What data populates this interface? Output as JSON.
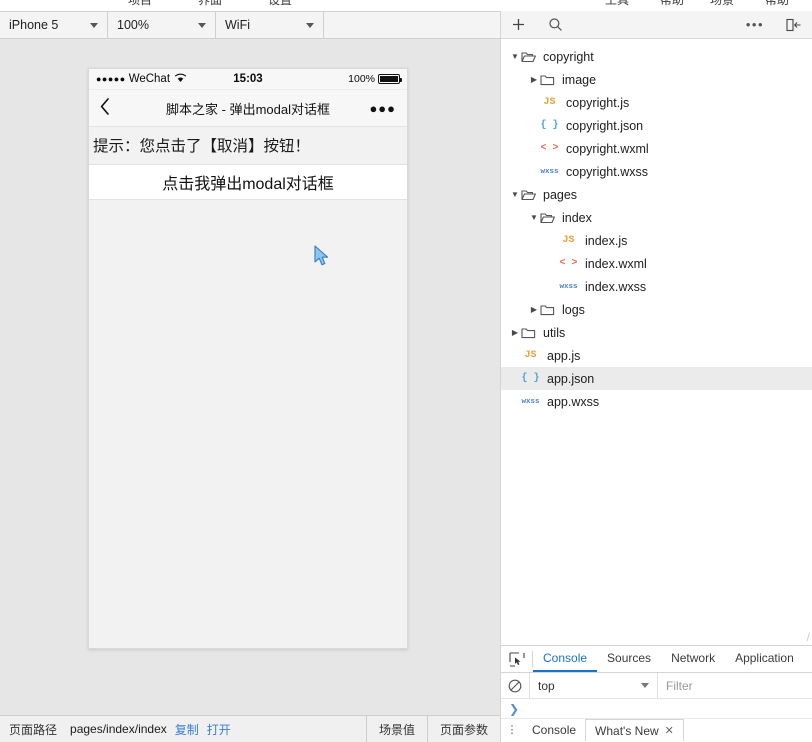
{
  "menu_strip": {
    "items": [
      "项目",
      "界面",
      "设置",
      "工具",
      "帮助"
    ]
  },
  "simulator_toolbar": {
    "device": {
      "value": "iPhone 5",
      "icon": "chevron-down-icon"
    },
    "zoom": {
      "value": "100%",
      "icon": "chevron-down-icon"
    },
    "network": {
      "value": "WiFi",
      "icon": "chevron-down-icon"
    }
  },
  "phone": {
    "status_bar": {
      "signal_dots": "●●●●●",
      "carrier": "WeChat",
      "wifi_icon": "wifi-icon",
      "time": "15:03",
      "battery_text": "100%",
      "battery_icon": "battery-full-icon"
    },
    "nav_bar": {
      "back_icon": "chevron-left-icon",
      "title": "脚本之家 - 弹出modal对话框",
      "more_icon": "more-dots-icon"
    },
    "content": {
      "tip": "提示：您点击了【取消】按钮！",
      "button_label": "点击我弹出modal对话框"
    },
    "cursor_icon": "mouse-pointer-icon"
  },
  "bottom_bar": {
    "label": "页面路径",
    "path": "pages/index/index",
    "copy_label": "复制",
    "open_label": "打开",
    "tabs": [
      "场景值",
      "页面参数"
    ]
  },
  "file_toolbar": {
    "add_icon": "plus-icon",
    "search_icon": "search-icon",
    "more_icon": "more-dots-icon",
    "dock_icon": "dock-to-left-icon"
  },
  "file_tree": [
    {
      "name": "copyright",
      "kind": "folder",
      "depth": 0,
      "expanded": true,
      "selected": false
    },
    {
      "name": "image",
      "kind": "folder",
      "depth": 1,
      "expanded": false,
      "selected": false
    },
    {
      "name": "copyright.js",
      "kind": "js",
      "depth": 1,
      "selected": false
    },
    {
      "name": "copyright.json",
      "kind": "json",
      "depth": 1,
      "selected": false
    },
    {
      "name": "copyright.wxml",
      "kind": "wxml",
      "depth": 1,
      "selected": false
    },
    {
      "name": "copyright.wxss",
      "kind": "wxss",
      "depth": 1,
      "selected": false
    },
    {
      "name": "pages",
      "kind": "folder",
      "depth": 0,
      "expanded": true,
      "selected": false
    },
    {
      "name": "index",
      "kind": "folder",
      "depth": 1,
      "expanded": true,
      "selected": false
    },
    {
      "name": "index.js",
      "kind": "js",
      "depth": 2,
      "selected": false
    },
    {
      "name": "index.wxml",
      "kind": "wxml",
      "depth": 2,
      "selected": false
    },
    {
      "name": "index.wxss",
      "kind": "wxss",
      "depth": 2,
      "selected": false
    },
    {
      "name": "logs",
      "kind": "folder",
      "depth": 1,
      "expanded": false,
      "selected": false
    },
    {
      "name": "utils",
      "kind": "folder",
      "depth": 0,
      "expanded": false,
      "selected": false
    },
    {
      "name": "app.js",
      "kind": "js",
      "depth": 0,
      "selected": false
    },
    {
      "name": "app.json",
      "kind": "json",
      "depth": 0,
      "selected": true
    },
    {
      "name": "app.wxss",
      "kind": "wxss",
      "depth": 0,
      "selected": false
    }
  ],
  "devtools": {
    "inspect_icon": "inspect-element-icon",
    "tabs": [
      {
        "label": "Console",
        "active": true
      },
      {
        "label": "Sources",
        "active": false
      },
      {
        "label": "Network",
        "active": false
      },
      {
        "label": "Application",
        "active": false
      }
    ],
    "clear_icon": "clear-console-icon",
    "context": {
      "value": "top",
      "icon": "chevron-down-icon"
    },
    "filter_placeholder": "Filter",
    "prompt_icon": "console-prompt-icon",
    "drawer": {
      "kebab_icon": "kebab-menu-icon",
      "tabs": [
        {
          "label": "Console",
          "closable": false
        },
        {
          "label": "What's New",
          "closable": true
        }
      ],
      "close_icon": "close-icon"
    }
  },
  "icon_colors": {
    "js": "#e3a13a",
    "json": "#4ba3d8",
    "wxml": "#e06a4e",
    "wxss": "#4a7ec8",
    "folder": "#555555",
    "accent": "#1a73c9",
    "link": "#3a7fd5"
  }
}
